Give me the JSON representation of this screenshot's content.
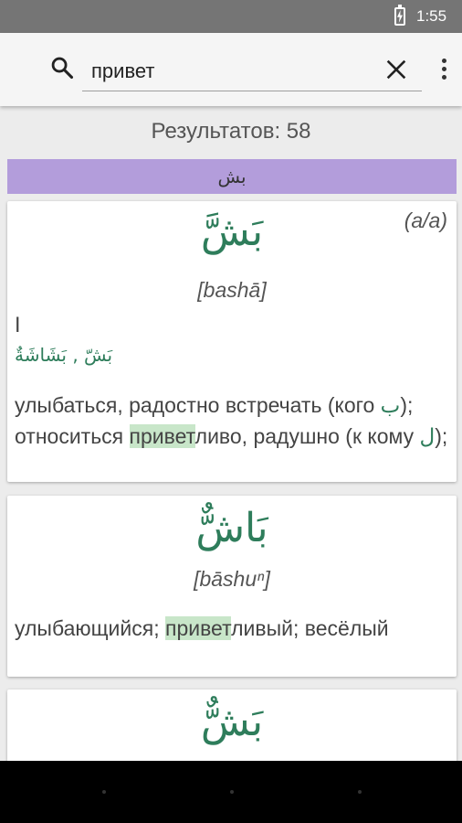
{
  "status_bar": {
    "time": "1:55"
  },
  "search": {
    "value": "привет"
  },
  "results": {
    "count_label": "Результатов: 58",
    "root": "بش",
    "entries": [
      {
        "arabic": "بَشَّ",
        "translit": "[bashā]",
        "pattern": "(a/a)",
        "roman": "I",
        "forms": "بَشّ , بَشَاشَةٌ",
        "meaning": {
          "p1": "улыбаться, радостно встречать (кого ",
          "ar1": "ب",
          "p2": "); относиться ",
          "hl": "привет",
          "p3": "ливо, радушно (к кому ",
          "ar2": "ل",
          "p4": ");"
        }
      },
      {
        "arabic": "بَاشٌّ",
        "translit": "[bāshuⁿ]",
        "meaning": {
          "p1": "улыбающийся; ",
          "hl": "привет",
          "p2": "ливый; весёлый"
        }
      },
      {
        "arabic": "بَشٌّ"
      }
    ]
  }
}
